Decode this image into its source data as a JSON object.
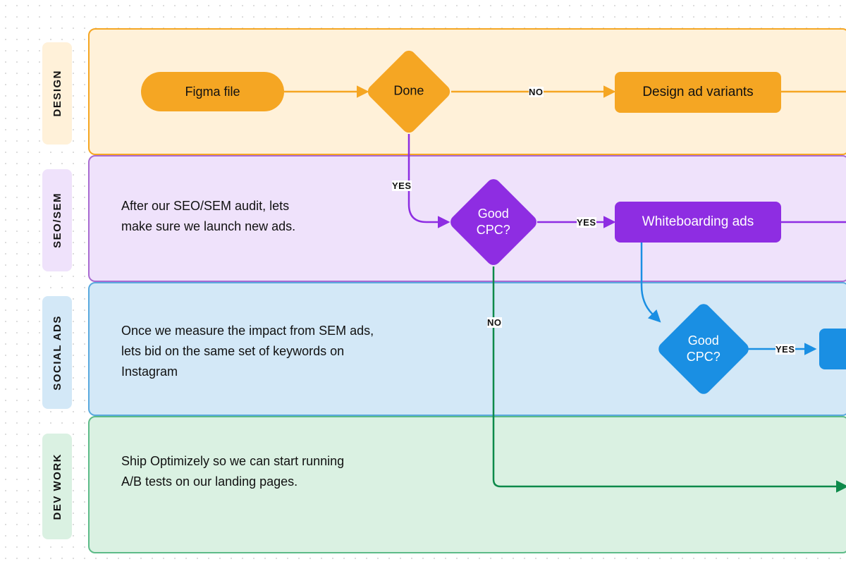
{
  "lanes": {
    "design": "DESIGN",
    "seo": "SEO/SEM",
    "social": "SOCIAL ADS",
    "dev": "DEV WORK"
  },
  "nodes": {
    "figma": "Figma file",
    "done": "Done",
    "design_variants": "Design ad variants",
    "good_cpc_seo": "Good CPC?",
    "whiteboarding": "Whiteboarding ads",
    "good_cpc_social": "Good CPC?"
  },
  "lane_text": {
    "seo": "After our SEO/SEM audit, lets make sure we launch new ads.",
    "social": "Once we measure the impact from SEM ads, lets bid on the same set of keywords on Instagram",
    "dev": "Ship Optimizely so we can start running A/B tests on our landing pages."
  },
  "edge_labels": {
    "done_no": "NO",
    "done_yes": "YES",
    "cpc_seo_yes": "YES",
    "cpc_seo_no": "NO",
    "cpc_social_yes": "YES"
  }
}
